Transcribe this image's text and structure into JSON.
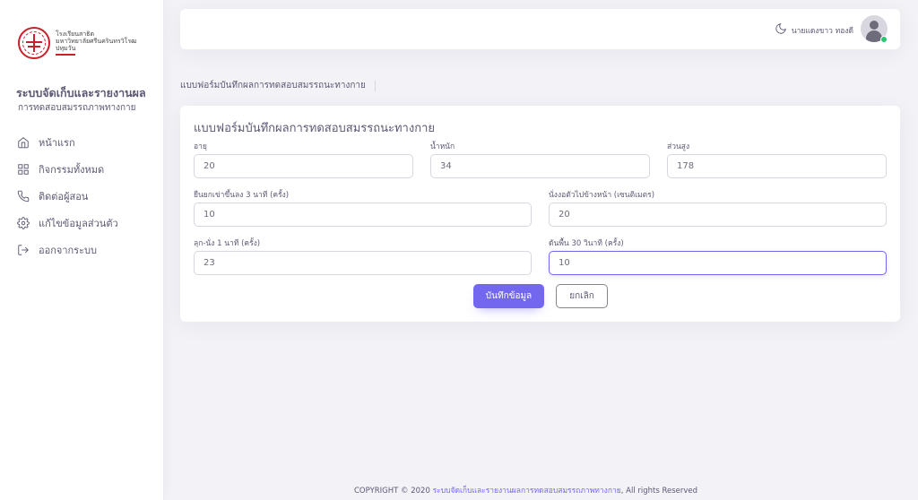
{
  "logo": {
    "line1": "โรงเรียนสาธิต",
    "line2": "มหาวิทยาลัยศรีนครินทรวิโรฒ",
    "line3": "ปทุมวัน"
  },
  "sidebar": {
    "title": "ระบบจัดเก็บและรายงานผล",
    "subtitle": "การทดสอบสมรรถภาพทางกาย",
    "items": [
      {
        "label": "หน้าแรก",
        "icon": "home-icon"
      },
      {
        "label": "กิจกรรมทั้งหมด",
        "icon": "grid-icon"
      },
      {
        "label": "ติดต่อผู้สอน",
        "icon": "phone-icon"
      },
      {
        "label": "แก้ไขข้อมูลส่วนตัว",
        "icon": "gear-icon"
      },
      {
        "label": "ออกจากระบบ",
        "icon": "logout-icon"
      }
    ]
  },
  "header": {
    "username": "นายแดงขาว ทองดี",
    "status_color": "#28c76f"
  },
  "breadcrumb": "แบบฟอร์มบันทึกผลการทดสอบสมรรถนะทางกาย",
  "form": {
    "title": "แบบฟอร์มบันทึกผลการทดสอบสมรรถนะทางกาย",
    "fields": {
      "age": {
        "label": "อายุ",
        "value": "20"
      },
      "weight": {
        "label": "น้ำหนัก",
        "value": "34"
      },
      "height": {
        "label": "ส่วนสูง",
        "value": "178"
      },
      "step_up": {
        "label": "ยืนยกเข่าขึ้นลง 3 นาที (ครั้ง)",
        "value": "10"
      },
      "sit_reach": {
        "label": "นั่งงอตัวไปข้างหน้า (เซนติเมตร)",
        "value": "20"
      },
      "sit_up": {
        "label": "ลุก-นั่ง 1 นาที (ครั้ง)",
        "value": "23"
      },
      "push_up": {
        "label": "ดันพื้น 30 วินาที (ครั้ง)",
        "value": "10"
      }
    },
    "save_label": "บันทึกข้อมูล",
    "cancel_label": "ยกเลิก"
  },
  "footer": {
    "prefix": "COPYRIGHT © 2020",
    "link": "ระบบจัดเก็บและรายงานผลการทดสอบสมรรถภาพทางกาย",
    "suffix": ", All rights Reserved"
  },
  "colors": {
    "accent": "#7367f0",
    "text": "#5e5873",
    "background": "#f3f2f7"
  }
}
